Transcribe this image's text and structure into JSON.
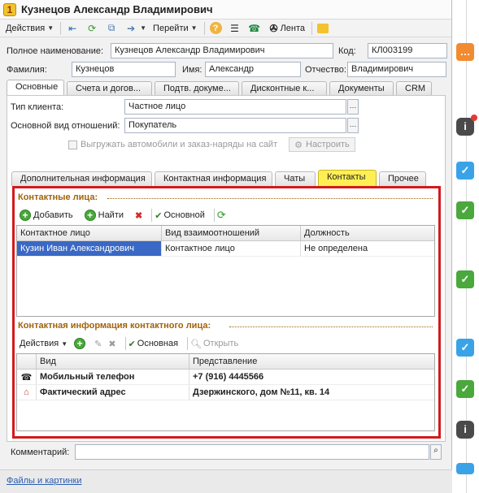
{
  "window": {
    "title": "Кузнецов Александр Владимирович",
    "logo_letter": "1"
  },
  "toolbar": {
    "actions_label": "Действия",
    "goto_label": "Перейти",
    "help_label": "?",
    "feed_label": "Лента"
  },
  "header": {
    "full_name_label": "Полное наименование:",
    "full_name_value": "Кузнецов Александр Владимирович",
    "code_label": "Код:",
    "code_value": "КЛ003199",
    "lastname_label": "Фамилия:",
    "lastname_value": "Кузнецов",
    "firstname_label": "Имя:",
    "firstname_value": "Александр",
    "patronymic_label": "Отчество:",
    "patronymic_value": "Владимирович"
  },
  "main_tabs": [
    "Основные",
    "Счета и догов...",
    "Подтв. докуме...",
    "Дисконтные к...",
    "Документы",
    "CRM"
  ],
  "basic": {
    "client_type_label": "Тип клиента:",
    "client_type_value": "Частное лицо",
    "relation_label": "Основной вид отношений:",
    "relation_value": "Покупатель",
    "upload_checkbox_label": "Выгружать автомобили и заказ-наряды на сайт",
    "configure_label": "Настроить"
  },
  "sub_tabs": [
    "Дополнительная информация",
    "Контактная информация",
    "Чаты",
    "Контакты",
    "Прочее"
  ],
  "contacts": {
    "title": "Контактные лица:",
    "add_label": "Добавить",
    "find_label": "Найти",
    "main_label": "Основной",
    "columns": [
      "Контактное лицо",
      "Вид взаимоотношений",
      "Должность"
    ],
    "rows": [
      [
        "Кузин Иван Александрович",
        "Контактное лицо",
        "Не определена"
      ]
    ]
  },
  "contact_info": {
    "title": "Контактная информация контактного лица:",
    "actions_label": "Действия",
    "main_label": "Основная",
    "open_label": "Открыть",
    "columns": [
      "Вид",
      "Представление"
    ],
    "rows": [
      {
        "icon": "phone-icon",
        "kind": "Мобильный телефон",
        "value": "+7 (916) 4445566"
      },
      {
        "icon": "house-icon",
        "kind": "Фактический адрес",
        "value": "Дзержинского, дом №11, кв. 14"
      }
    ]
  },
  "comment": {
    "label": "Комментарий:",
    "value": ""
  },
  "footer": {
    "link": "Файлы и картинки"
  },
  "colors": {
    "highlight": "#d3191d",
    "selection": "#3a68c5",
    "active_tab": "#ffef55",
    "group_title": "#a0630a"
  }
}
